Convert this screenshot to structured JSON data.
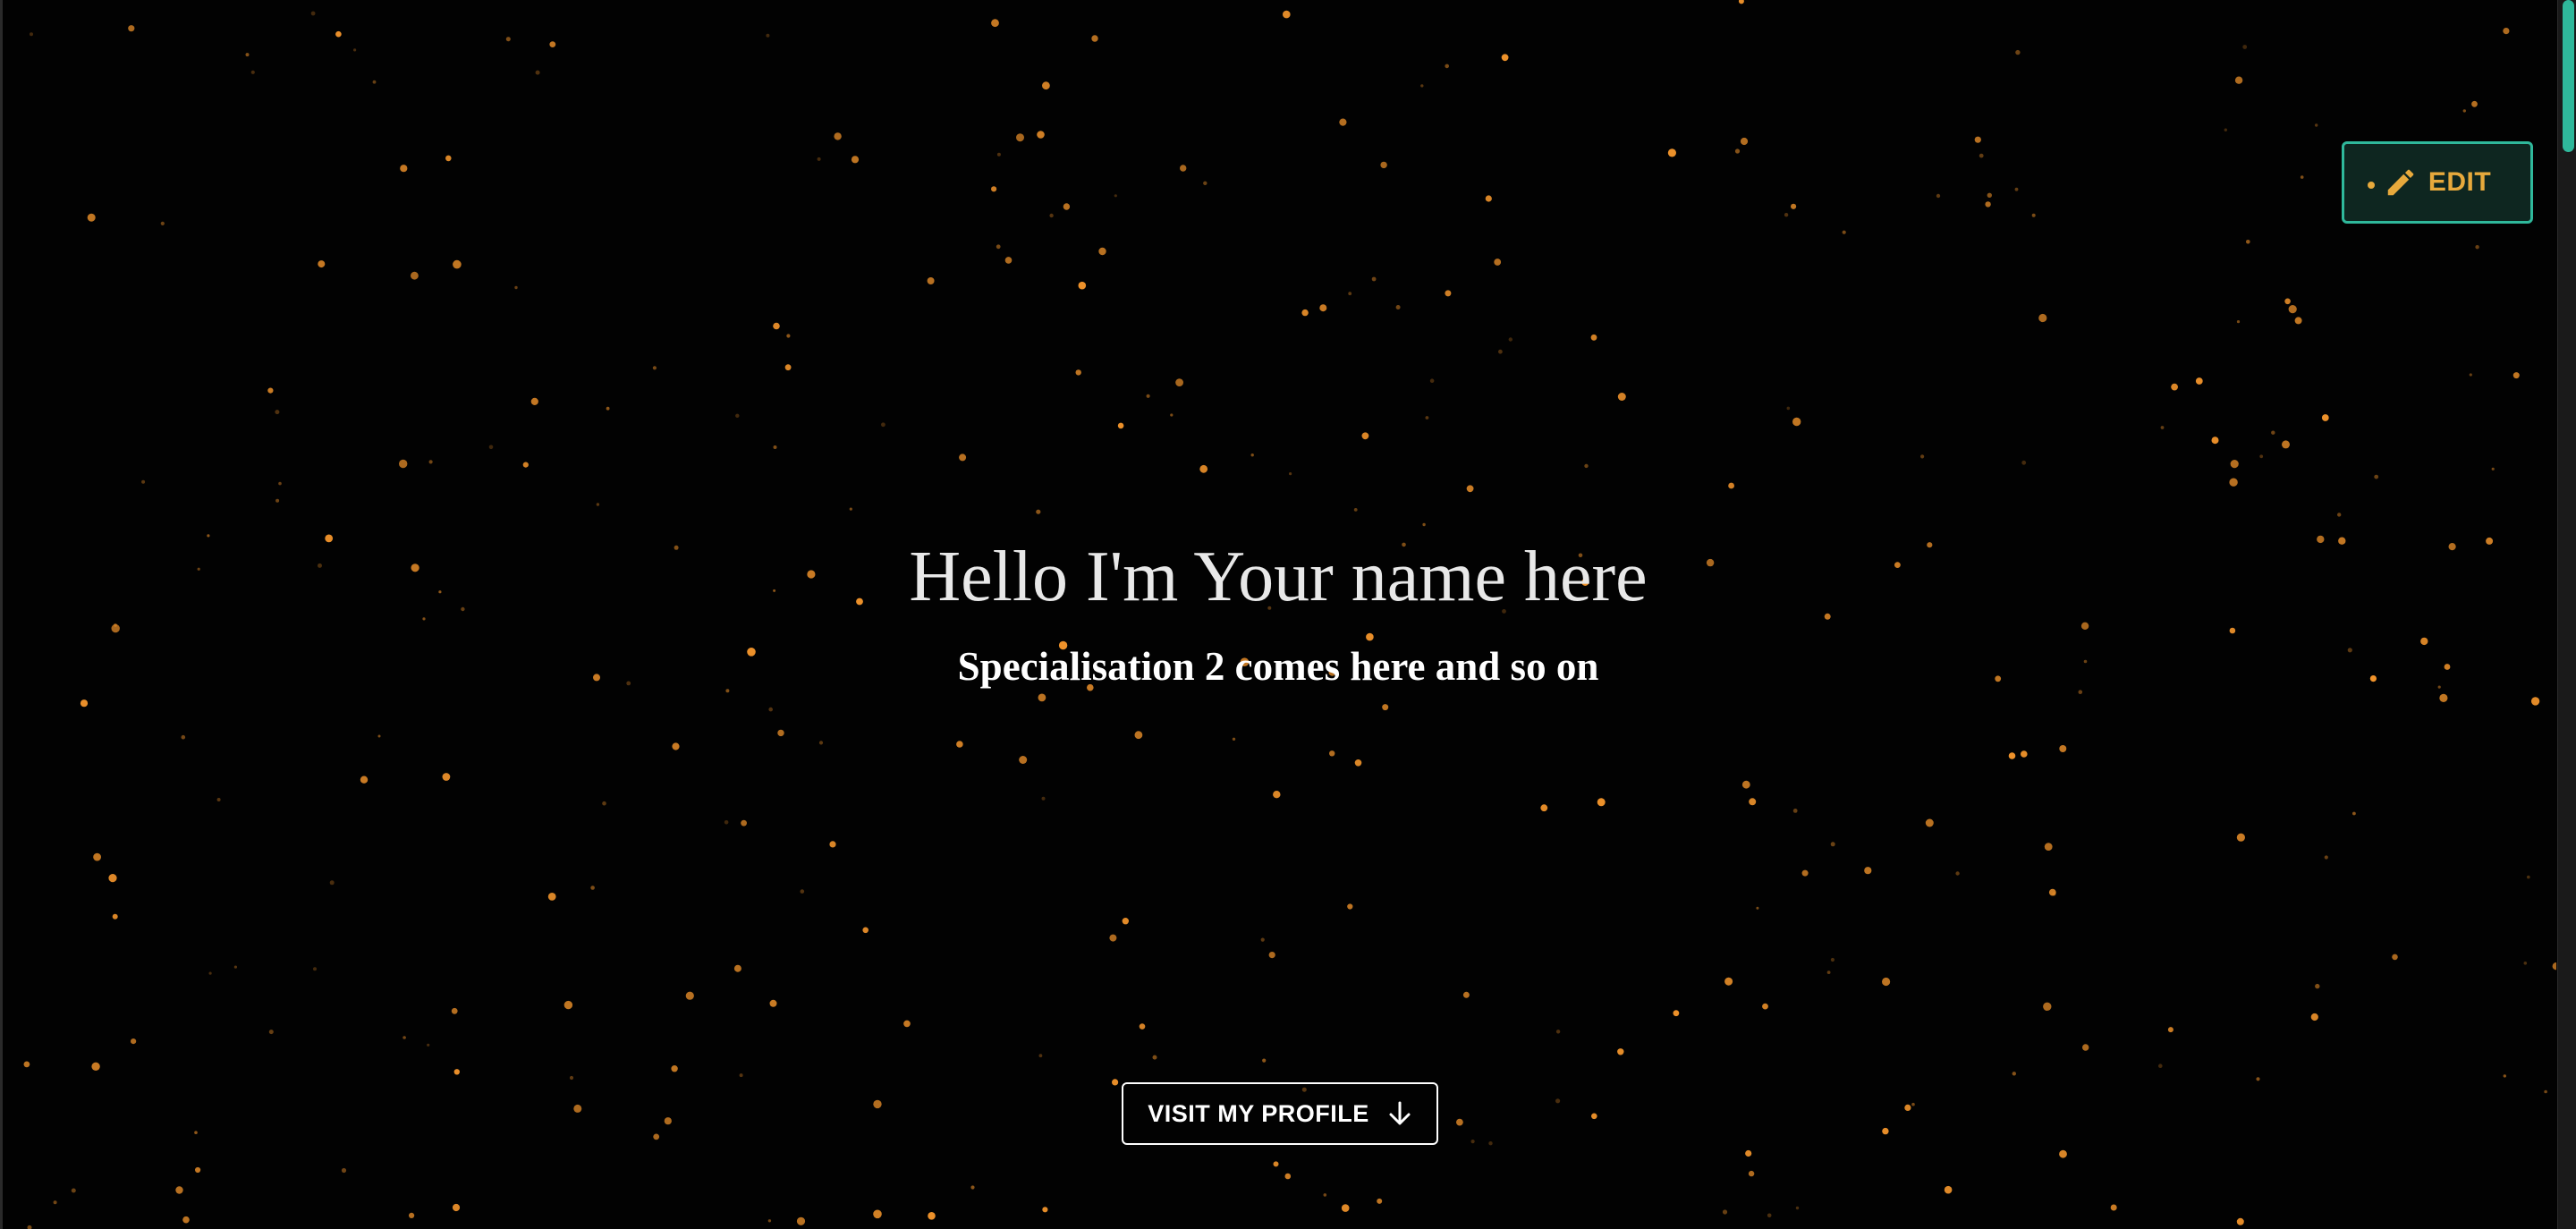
{
  "hero": {
    "title": "Hello I'm Your name here",
    "subtitle": "Specialisation 2 comes here and so on"
  },
  "actions": {
    "visit_label": "VISIT MY PROFILE",
    "visit_icon": "arrow-down-icon",
    "edit_label": "EDIT",
    "edit_icon": "pencil-icon"
  },
  "theme": {
    "background": "#020202",
    "star_color": "#f0932b",
    "accent": "#2fb89b",
    "edit_text": "#e7a93c",
    "text": "#ffffff"
  }
}
